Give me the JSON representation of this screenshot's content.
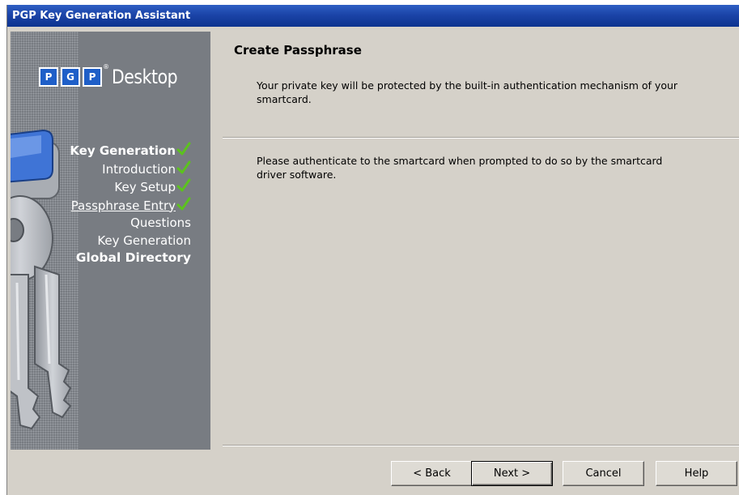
{
  "window": {
    "title": "PGP Key Generation Assistant"
  },
  "logo": {
    "letters": [
      "P",
      "G",
      "P"
    ],
    "registered": "®",
    "product": "Desktop"
  },
  "steps": [
    {
      "label": "Key Generation",
      "kind": "group",
      "checked": true,
      "current": false
    },
    {
      "label": "Introduction",
      "kind": "sub",
      "checked": true,
      "current": false
    },
    {
      "label": "Key Setup",
      "kind": "sub",
      "checked": true,
      "current": false
    },
    {
      "label": "Passphrase Entry",
      "kind": "sub",
      "checked": true,
      "current": true
    },
    {
      "label": "Questions",
      "kind": "sub",
      "checked": false,
      "current": false
    },
    {
      "label": "Key Generation",
      "kind": "sub",
      "checked": false,
      "current": false
    },
    {
      "label": "Global Directory",
      "kind": "group",
      "checked": false,
      "current": false
    }
  ],
  "page": {
    "title": "Create Passphrase",
    "description": "Your private key will be protected by the built-in authentication mechanism of your smartcard.",
    "instructions": "Please authenticate to the smartcard when prompted to do so by the smartcard driver software."
  },
  "buttons": {
    "back": "< Back",
    "next": "Next >",
    "cancel": "Cancel",
    "help": "Help"
  },
  "colors": {
    "titlebar": "#1b44a8",
    "panel": "#787c82",
    "dialog": "#d5d1c9",
    "check": "#5cc21e",
    "logo_blue": "#1f5fc8"
  }
}
